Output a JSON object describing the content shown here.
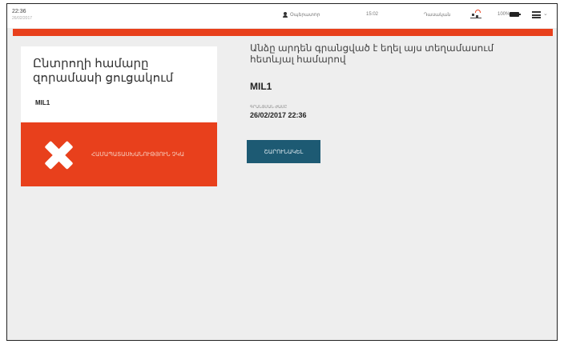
{
  "status_bar": {
    "time": "22:36",
    "date": "26/02/2017",
    "user_label": "Օպերատոր",
    "time2": "15:02",
    "mode_label": "Դասական",
    "battery_percent": "100%",
    "icons": {
      "user": "user-icon",
      "network": "network-icon",
      "battery": "battery-icon",
      "menu": "menu-icon",
      "chevron": "chevron-down-icon"
    }
  },
  "colors": {
    "accent": "#e8401c",
    "button": "#1d5a73",
    "background": "#eeeeee",
    "card": "#ffffff"
  },
  "left_card": {
    "title": "Ընտրողի համարը զորամասի ցուցակում",
    "code": "MIL1",
    "status_text": "ՀԱՄԱՊԱՏԱՍԽԱՆՈՒԹՅՈՒՆ ՉԿԱ",
    "status_icon": "close-icon"
  },
  "main": {
    "message": "Անձը արդեն գրանցված է եղել այս տեղամասում հետևյալ համարով",
    "code": "MIL1",
    "date_label": "ԳՐԱՆՑՄԱՆ ԺԱՄԸ",
    "date_value": "26/02/2017 22:36",
    "button_label": "ՇԱՐՈՒՆԱԿԵԼ"
  }
}
